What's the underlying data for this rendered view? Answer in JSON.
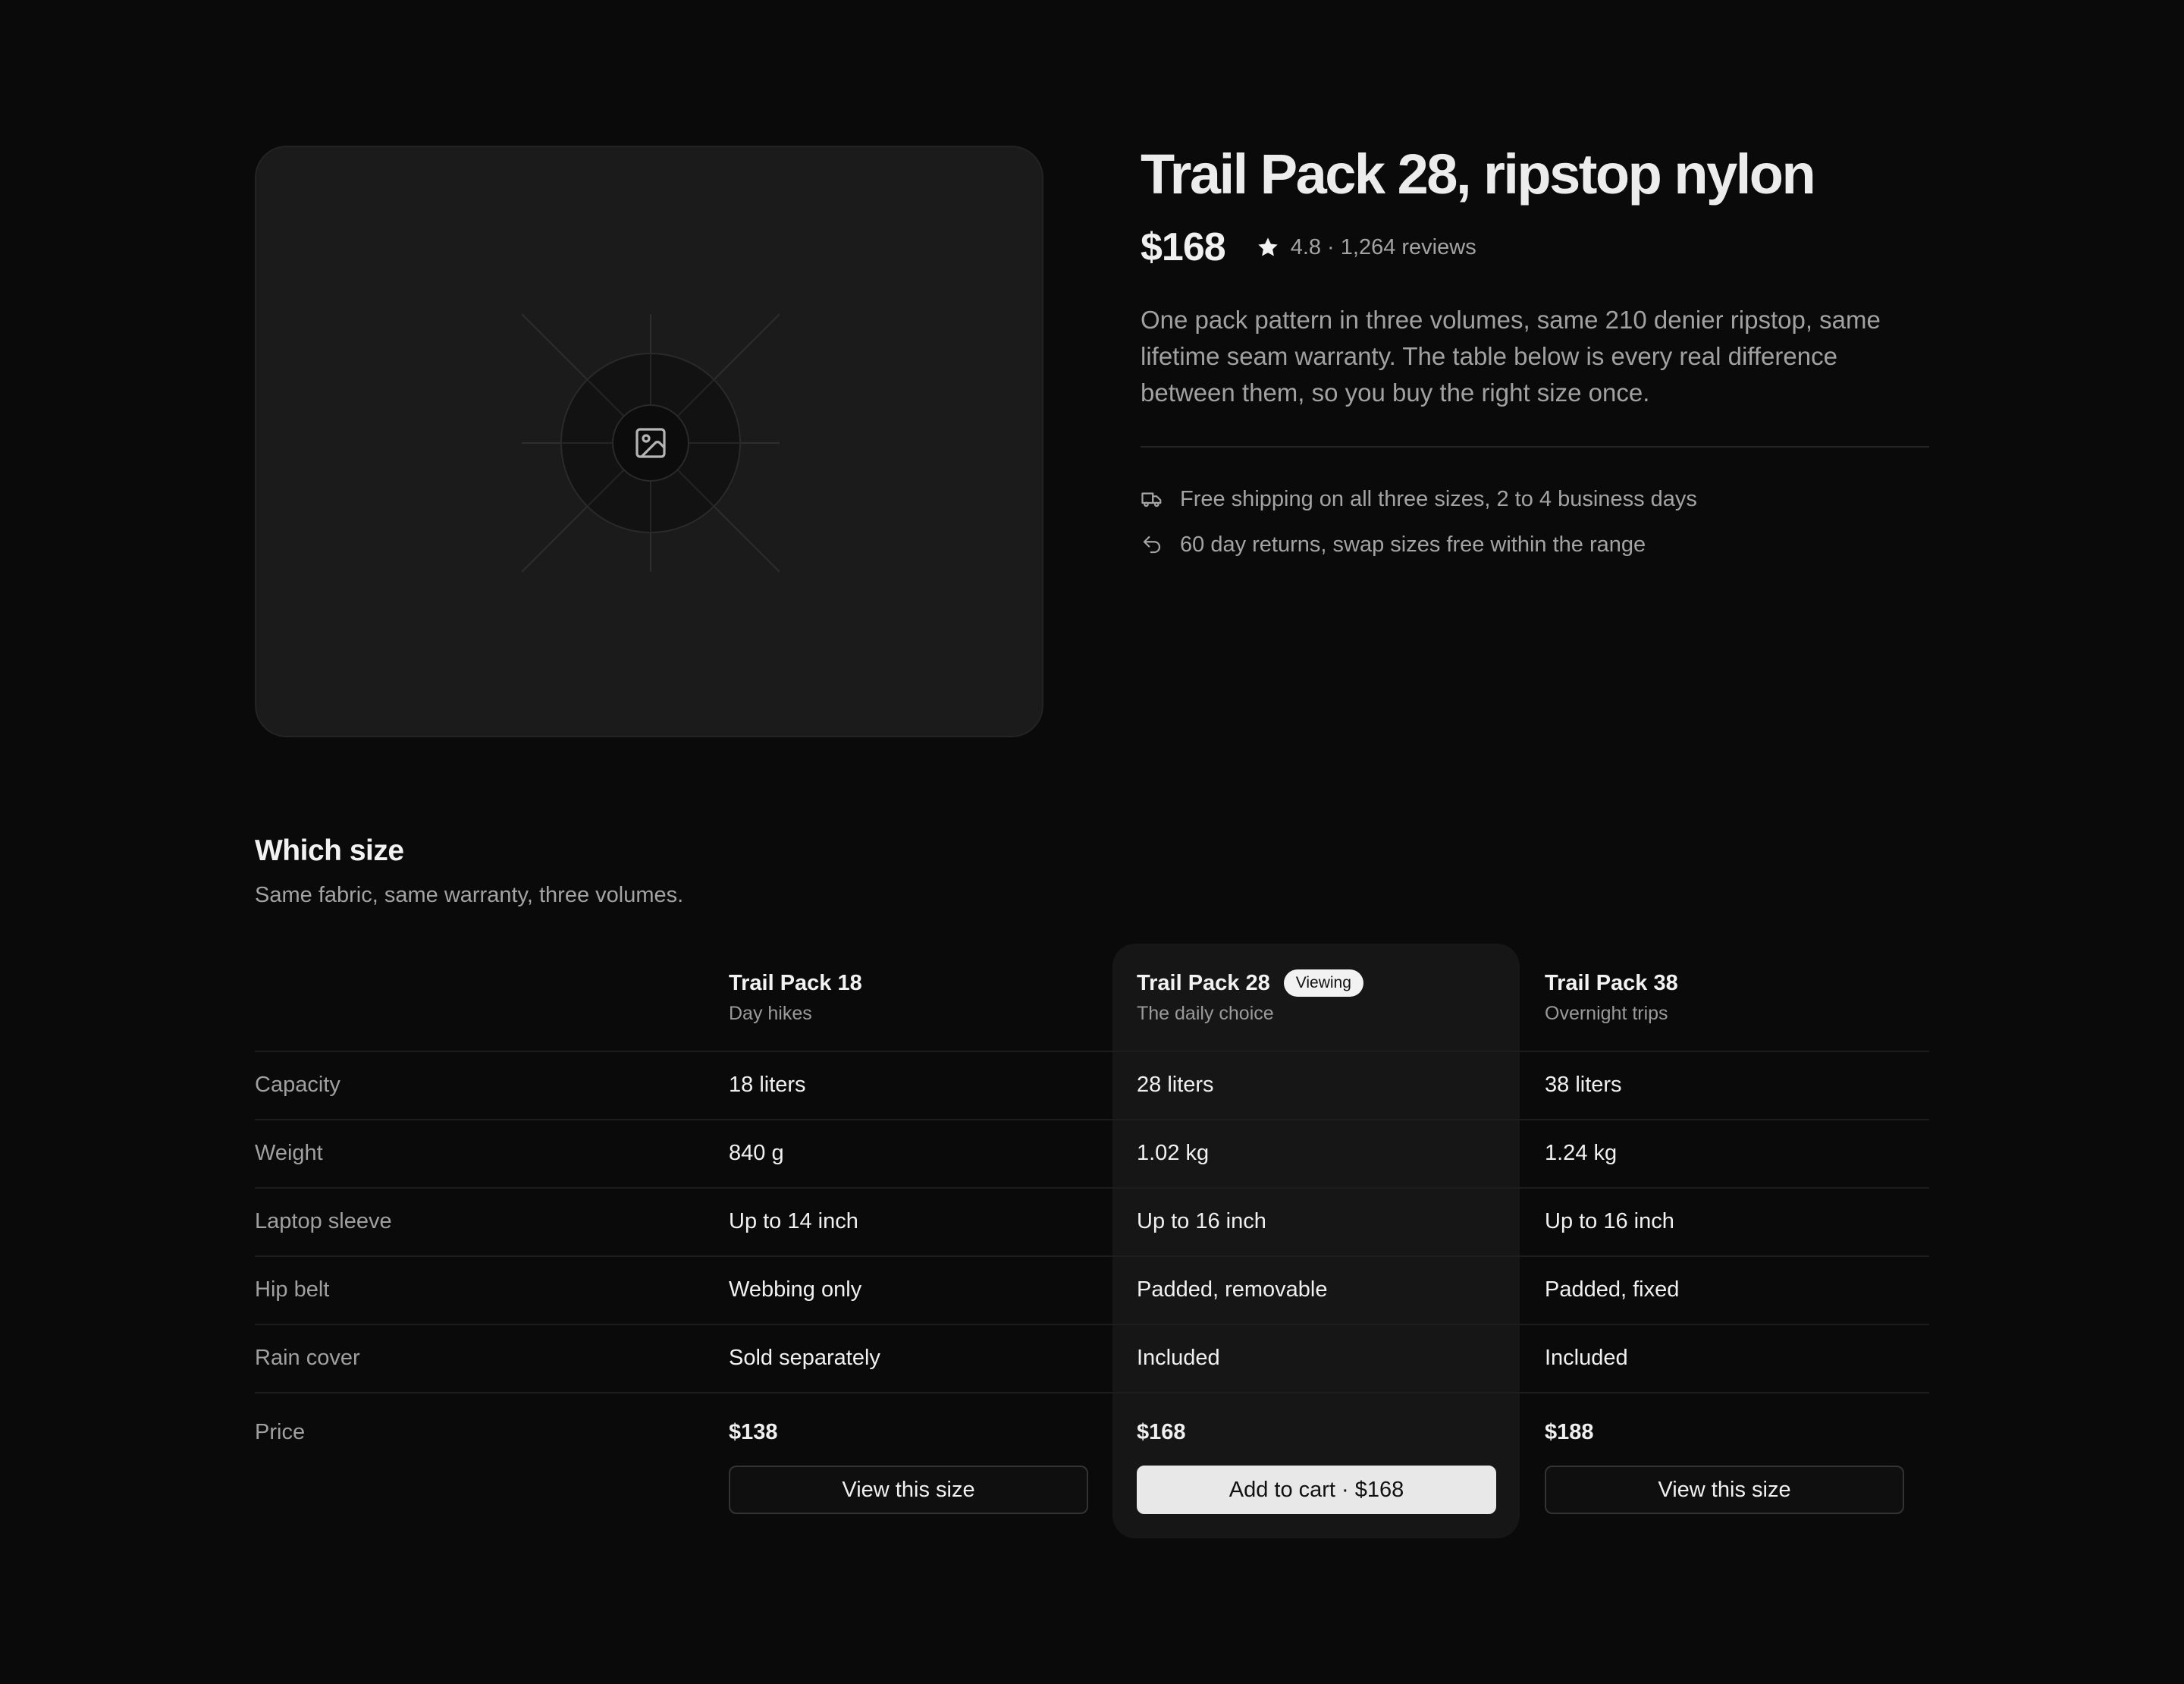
{
  "hero": {
    "image_icon": "image-placeholder-icon"
  },
  "product": {
    "title": "Trail Pack 28, ripstop nylon",
    "price": "$168",
    "rating": "4.8 · 1,264 reviews",
    "rating_icon": "star-icon",
    "description": "One pack pattern in three volumes, same 210 denier ripstop, same lifetime seam warranty. The table below is every real difference between them, so you buy the right size once.",
    "perks": [
      {
        "icon": "truck-icon",
        "text": "Free shipping on all three sizes, 2 to 4 business days"
      },
      {
        "icon": "return-arrow-icon",
        "text": "60 day returns, swap sizes free within the range"
      }
    ]
  },
  "compare": {
    "title": "Which size",
    "subtitle": "Same fabric, same warranty, three volumes.",
    "columns": [
      {
        "name": "Trail Pack 18",
        "tagline": "Day hikes"
      },
      {
        "name": "Trail Pack 28",
        "tagline": "The daily choice",
        "badge": "Viewing"
      },
      {
        "name": "Trail Pack 38",
        "tagline": "Overnight trips"
      }
    ],
    "rows": [
      {
        "label": "Capacity",
        "values": [
          "18 liters",
          "28 liters",
          "38 liters"
        ]
      },
      {
        "label": "Weight",
        "values": [
          "840 g",
          "1.02 kg",
          "1.24 kg"
        ]
      },
      {
        "label": "Laptop sleeve",
        "values": [
          "Up to 14 inch",
          "Up to 16 inch",
          "Up to 16 inch"
        ]
      },
      {
        "label": "Hip belt",
        "values": [
          "Webbing only",
          "Padded, removable",
          "Padded, fixed"
        ]
      },
      {
        "label": "Rain cover",
        "values": [
          "Sold separately",
          "Included",
          "Included"
        ]
      }
    ],
    "price_row": {
      "label": "Price",
      "values": [
        "$138",
        "$168",
        "$188"
      ],
      "buttons": [
        "View this size",
        "Add to cart · $168",
        "View this size"
      ]
    }
  },
  "colors": {
    "background": "#0a0a0a",
    "card": "#1b1b1b",
    "highlight": "#161616",
    "accent_button": "#e8e8e8"
  }
}
